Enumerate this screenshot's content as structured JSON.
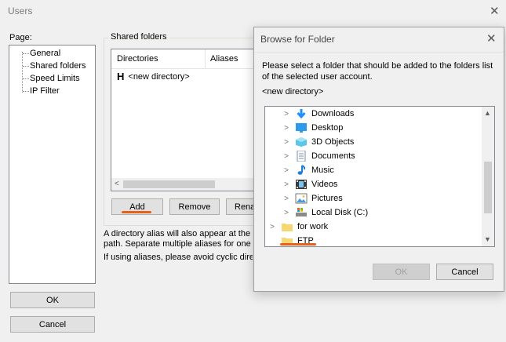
{
  "window": {
    "title": "Users"
  },
  "page_panel": {
    "label": "Page:",
    "items": [
      "General",
      "Shared folders",
      "Speed Limits",
      "IP Filter"
    ],
    "selected": "Shared folders"
  },
  "shared_folders": {
    "group_label": "Shared folders",
    "columns": [
      "Directories",
      "Aliases"
    ],
    "rows": [
      {
        "marker": "H",
        "directory": "<new directory>"
      }
    ],
    "buttons": {
      "add": "Add",
      "remove": "Remove",
      "rename": "Rena"
    },
    "note1_line1": "A directory alias will also appear at the sp",
    "note1_line2": "path. Separate multiple aliases for one di",
    "note2": "If using aliases, please avoid cyclic direc"
  },
  "footer_buttons": {
    "ok": "OK",
    "cancel": "Cancel"
  },
  "browse_dialog": {
    "title": "Browse for Folder",
    "prompt_line1": "Please select a folder that should be added to the folders list",
    "prompt_line2": "of the selected user account.",
    "current": "<new directory>",
    "folders": [
      {
        "label": "Downloads",
        "icon": "downloads-icon"
      },
      {
        "label": "Desktop",
        "icon": "desktop-icon"
      },
      {
        "label": "3D Objects",
        "icon": "3d-objects-icon"
      },
      {
        "label": "Documents",
        "icon": "documents-icon"
      },
      {
        "label": "Music",
        "icon": "music-icon"
      },
      {
        "label": "Videos",
        "icon": "videos-icon"
      },
      {
        "label": "Pictures",
        "icon": "pictures-icon"
      },
      {
        "label": "Local Disk (C:)",
        "icon": "local-disk-icon"
      },
      {
        "label": "for work",
        "icon": "folder-icon"
      },
      {
        "label": "FTP",
        "icon": "folder-icon"
      }
    ],
    "buttons": {
      "ok": "OK",
      "cancel": "Cancel"
    }
  },
  "colors": {
    "highlight_underline": "#e8611a",
    "folder_yellow": "#f7d774",
    "accent_blue": "#1e90ff"
  }
}
